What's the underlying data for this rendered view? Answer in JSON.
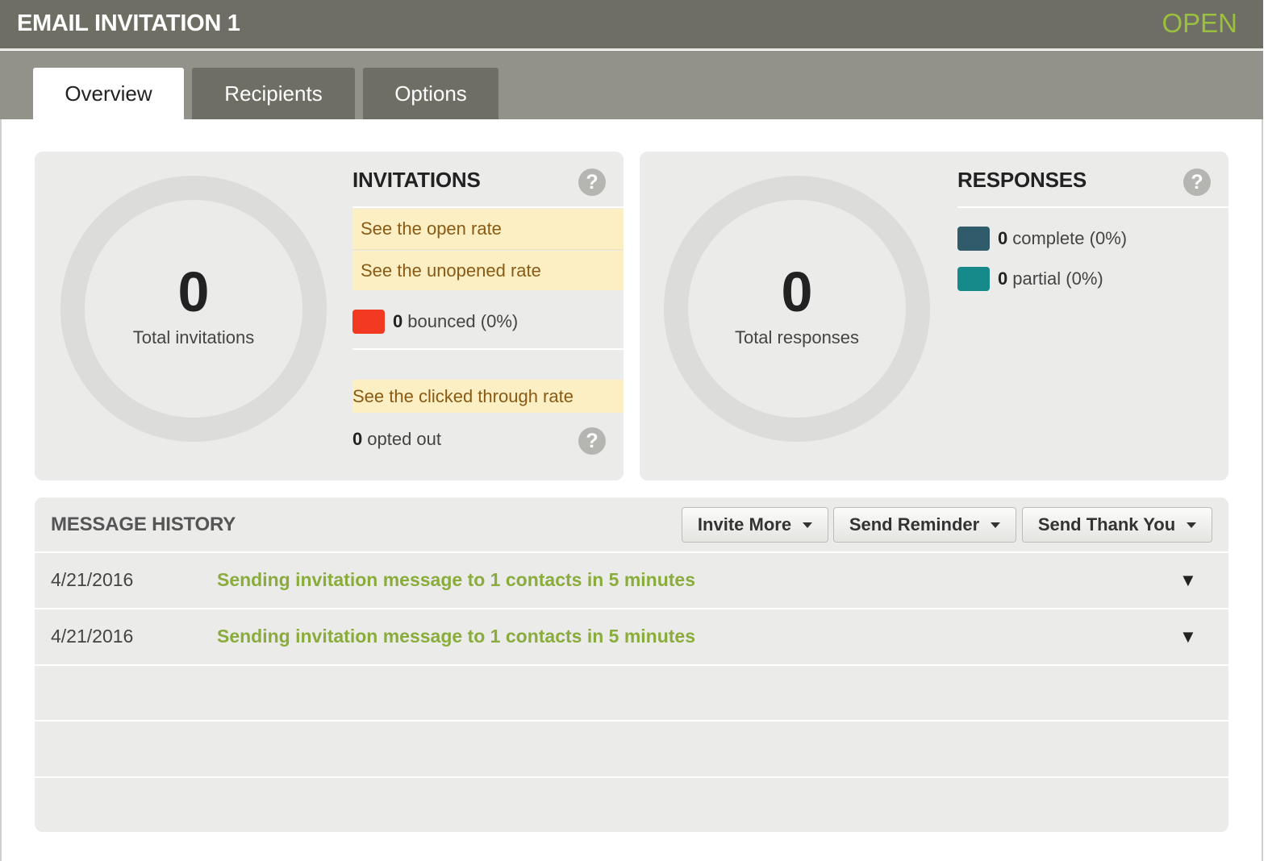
{
  "header": {
    "title": "EMAIL INVITATION 1",
    "status": "OPEN",
    "status_color": "#9bbf3f"
  },
  "tabs": [
    {
      "label": "Overview",
      "active": true
    },
    {
      "label": "Recipients",
      "active": false
    },
    {
      "label": "Options",
      "active": false
    }
  ],
  "invitations": {
    "total_value": "0",
    "total_label": "Total invitations",
    "title": "INVITATIONS",
    "help_icon": "?",
    "open_rate_link": "See the open rate",
    "unopened_rate_link": "See the unopened rate",
    "bounced_count": "0",
    "bounced_label": "bounced (0%)",
    "bounced_color": "#f23a22",
    "clicked_link": "See the clicked through rate",
    "opted_out_count": "0",
    "opted_out_label": "opted out"
  },
  "responses": {
    "total_value": "0",
    "total_label": "Total responses",
    "title": "RESPONSES",
    "help_icon": "?",
    "complete_count": "0",
    "complete_label": "complete (0%)",
    "complete_color": "#2f5b6b",
    "partial_count": "0",
    "partial_label": "partial (0%)",
    "partial_color": "#16898a"
  },
  "message_history": {
    "title": "MESSAGE HISTORY",
    "buttons": {
      "invite_more": "Invite More",
      "send_reminder": "Send Reminder",
      "send_thank_you": "Send Thank You"
    },
    "rows": [
      {
        "date": "4/21/2016",
        "message": "Sending invitation message to 1 contacts in 5 minutes",
        "toggle": "▼"
      },
      {
        "date": "4/21/2016",
        "message": "Sending invitation message to 1 contacts in 5 minutes",
        "toggle": "▼"
      }
    ]
  }
}
